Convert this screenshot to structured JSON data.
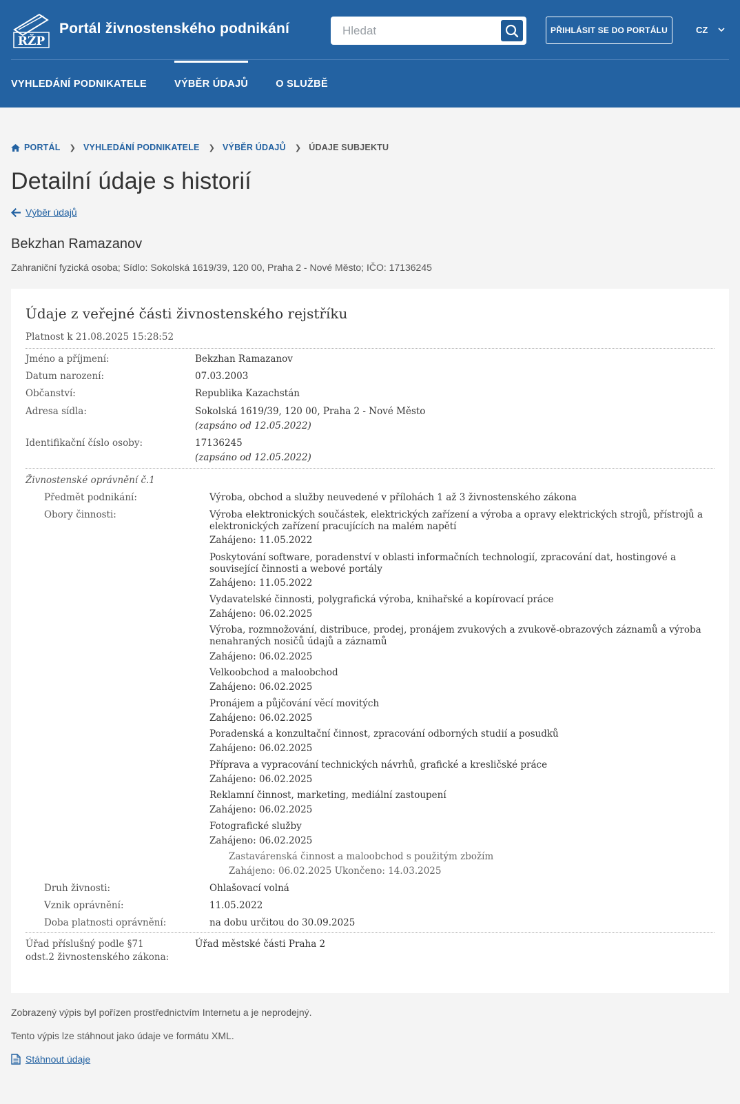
{
  "header": {
    "logo_text": "RŽP",
    "site_title": "Portál živnostenského podnikání",
    "search_placeholder": "Hledat",
    "login_label": "PŘIHLÁSIT SE DO PORTÁLU",
    "lang": "CZ"
  },
  "nav": [
    "VYHLEDÁNÍ PODNIKATELE",
    "VÝBĚR ÚDAJŮ",
    "O SLUŽBĚ"
  ],
  "breadcrumb": [
    "PORTÁL",
    "VYHLEDÁNÍ PODNIKATELE",
    "VÝBĚR ÚDAJŮ",
    "ÚDAJE SUBJEKTU"
  ],
  "page_title": "Detailní údaje s historií",
  "back_link": "Výběr údajů",
  "subject": {
    "name": "Bekzhan Ramazanov",
    "meta": "Zahraniční fyzická osoba;  Sídlo:  Sokolská 1619/39, 120 00, Praha 2 - Nové Město;  IČO:  17136245"
  },
  "card": {
    "title": "Údaje z veřejné části živnostenského rejstříku",
    "validity": "Platnost k 21.08.2025 15:28:52",
    "fields": [
      {
        "label": "Jméno a příjmení:",
        "value": "Bekzhan Ramazanov",
        "note": ""
      },
      {
        "label": "Datum narození:",
        "value": "07.03.2003",
        "note": ""
      },
      {
        "label": "Občanství:",
        "value": "Republika Kazachstán",
        "note": ""
      },
      {
        "label": "Adresa sídla:",
        "value": "Sokolská 1619/39, 120 00, Praha 2 - Nové Město",
        "note": "(zapsáno od 12.05.2022)"
      },
      {
        "label": "Identifikační číslo osoby:",
        "value": "17136245",
        "note": "(zapsáno od 12.05.2022)"
      }
    ],
    "license": {
      "title": "Živnostenské oprávnění č.1",
      "subject_label": "Předmět podnikání:",
      "subject_value": "Výroba, obchod a služby neuvedené v přílohách 1 až 3 živnostenského zákona",
      "fields_label": "Obory činnosti:",
      "activities": [
        {
          "name": "Výroba elektronických součástek, elektrických zařízení a výroba a opravy elektrických strojů, přístrojů a elektronických zařízení pracujících na malém napětí",
          "started": "Zahájeno: 11.05.2022"
        },
        {
          "name": "Poskytování software, poradenství v oblasti informačních technologií, zpracování dat, hostingové a související činnosti a webové portály",
          "started": "Zahájeno: 11.05.2022"
        },
        {
          "name": "Vydavatelské činnosti, polygrafická výroba, knihařské a kopírovací práce",
          "started": "Zahájeno: 06.02.2025"
        },
        {
          "name": "Výroba, rozmnožování, distribuce, prodej, pronájem zvukových a zvukově-obrazových záznamů a výroba nenahraných nosičů údajů a záznamů",
          "started": "Zahájeno: 06.02.2025"
        },
        {
          "name": "Velkoobchod a maloobchod",
          "started": "Zahájeno: 06.02.2025"
        },
        {
          "name": "Pronájem a půjčování věcí movitých",
          "started": "Zahájeno: 06.02.2025"
        },
        {
          "name": "Poradenská a konzultační činnost, zpracování odborných studií a posudků",
          "started": "Zahájeno: 06.02.2025"
        },
        {
          "name": "Příprava a vypracování technických návrhů, grafické a kresličské práce",
          "started": "Zahájeno: 06.02.2025"
        },
        {
          "name": "Reklamní činnost, marketing, mediální zastoupení",
          "started": "Zahájeno: 06.02.2025"
        },
        {
          "name": "Fotografické služby",
          "started": "Zahájeno: 06.02.2025"
        }
      ],
      "historical_activity": {
        "name": "Zastavárenská činnost a maloobchod s použitým zbožím",
        "dates": "Zahájeno: 06.02.2025 Ukončeno: 14.03.2025"
      },
      "type_label": "Druh živnosti:",
      "type_value": "Ohlašovací volná",
      "origin_label": "Vznik oprávnění:",
      "origin_value": "11.05.2022",
      "validity_label": "Doba platnosti oprávnění:",
      "validity_value": "na dobu určitou do 30.09.2025"
    },
    "office_label_1": "Úřad příslušný podle §71",
    "office_label_2": "odst.2 živnostenského zákona:",
    "office_value": "Úřad městské části Praha 2"
  },
  "footer": {
    "note1": "Zobrazený výpis byl pořízen prostřednictvím Internetu a je neprodejný.",
    "note2": "Tento výpis lze stáhnout jako údaje ve formátu XML.",
    "download_label": "Stáhnout údaje"
  },
  "colors": {
    "brand": "#2362a2",
    "background": "#f4f4f4"
  }
}
